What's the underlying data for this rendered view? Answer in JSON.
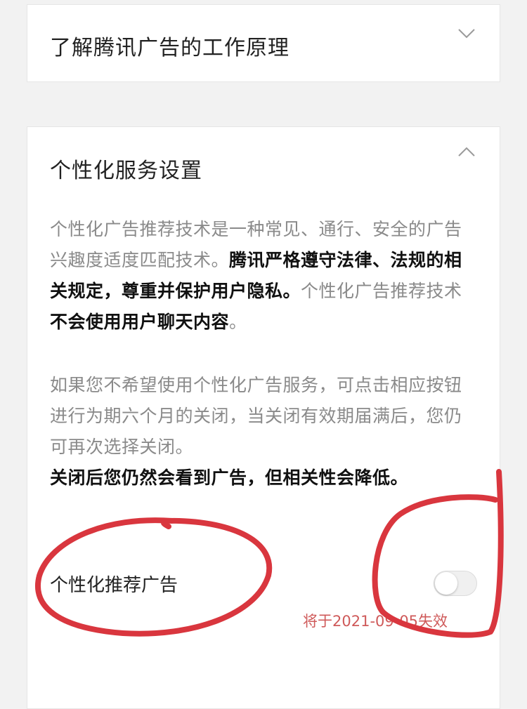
{
  "sections": [
    {
      "title": "了解腾讯广告的工作原理",
      "expanded": false,
      "chevron_icon": "chevron-down-icon"
    },
    {
      "title": "个性化服务设置",
      "expanded": true,
      "chevron_icon": "chevron-up-icon",
      "para1": {
        "text_a": "个性化广告推荐技术是一种常见、通行、安全的广告兴趣度适度匹配技术。",
        "bold_b": "腾讯严格遵守法律、法规的相关规定，尊重并保护用户隐私。",
        "text_c": "个性化广告推荐技术",
        "bold_d": "不会使用用户聊天内容",
        "text_e": "。"
      },
      "para2": "如果您不希望使用个性化广告服务，可点击相应按钮进行为期六个月的关闭，当关闭有效期届满后，您仍可再次选择关闭。",
      "para3": "关闭后您仍然会看到广告，但相关性会降低。",
      "toggle": {
        "label": "个性化推荐广告",
        "state": "off",
        "expire_note": "将于2021-09-05失效"
      }
    }
  ],
  "colors": {
    "background": "#f2f2f2",
    "card": "#ffffff",
    "body_text": "#8a8a8a",
    "bold_text": "#111111",
    "expire_note": "#cf5a5a",
    "annotation_marker": "#d9363e"
  }
}
